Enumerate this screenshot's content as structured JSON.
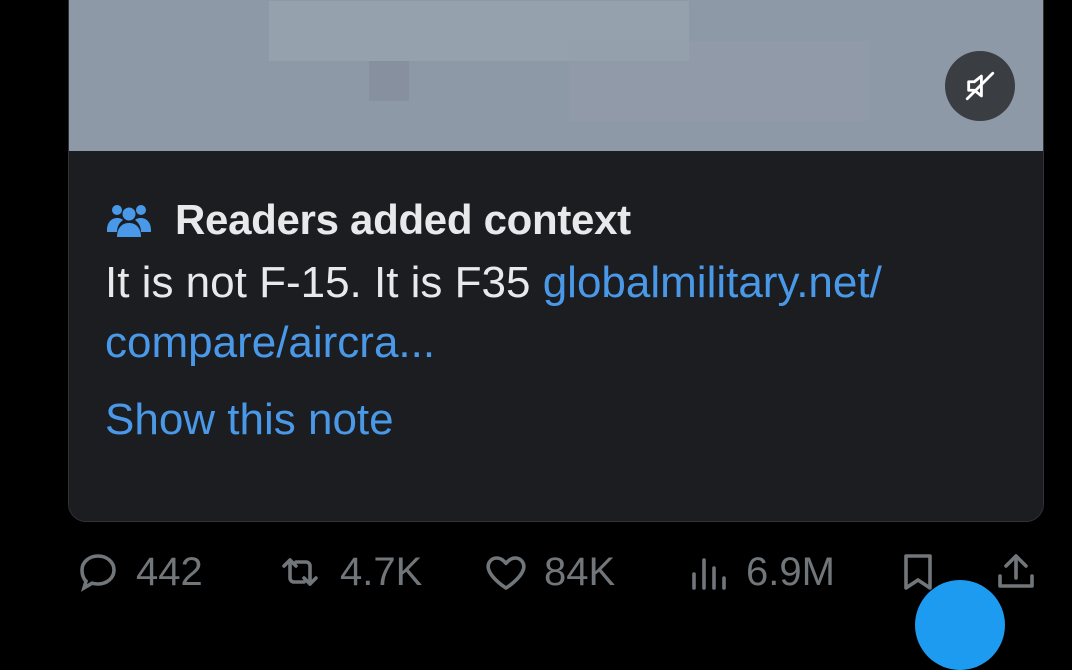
{
  "note": {
    "header": "Readers added context",
    "text": "It is not F-15. It is F35 ",
    "link_line1": "globalmilitary.net/",
    "link_line2": "compare/aircra...",
    "show_label": "Show this note"
  },
  "icons": {
    "mute": "speaker-muted-icon",
    "readers": "people-icon",
    "reply": "speech-bubble-icon",
    "repost": "repost-arrows-icon",
    "like": "heart-icon",
    "views": "bar-chart-icon",
    "bookmark": "bookmark-icon",
    "share": "share-upload-icon"
  },
  "actions": {
    "replies": "442",
    "reposts": "4.7K",
    "likes": "84K",
    "views": "6.9M"
  },
  "colors": {
    "accent": "#4a99e9",
    "text": "#e7e9ea",
    "muted": "#71767b",
    "background": "#000000"
  }
}
